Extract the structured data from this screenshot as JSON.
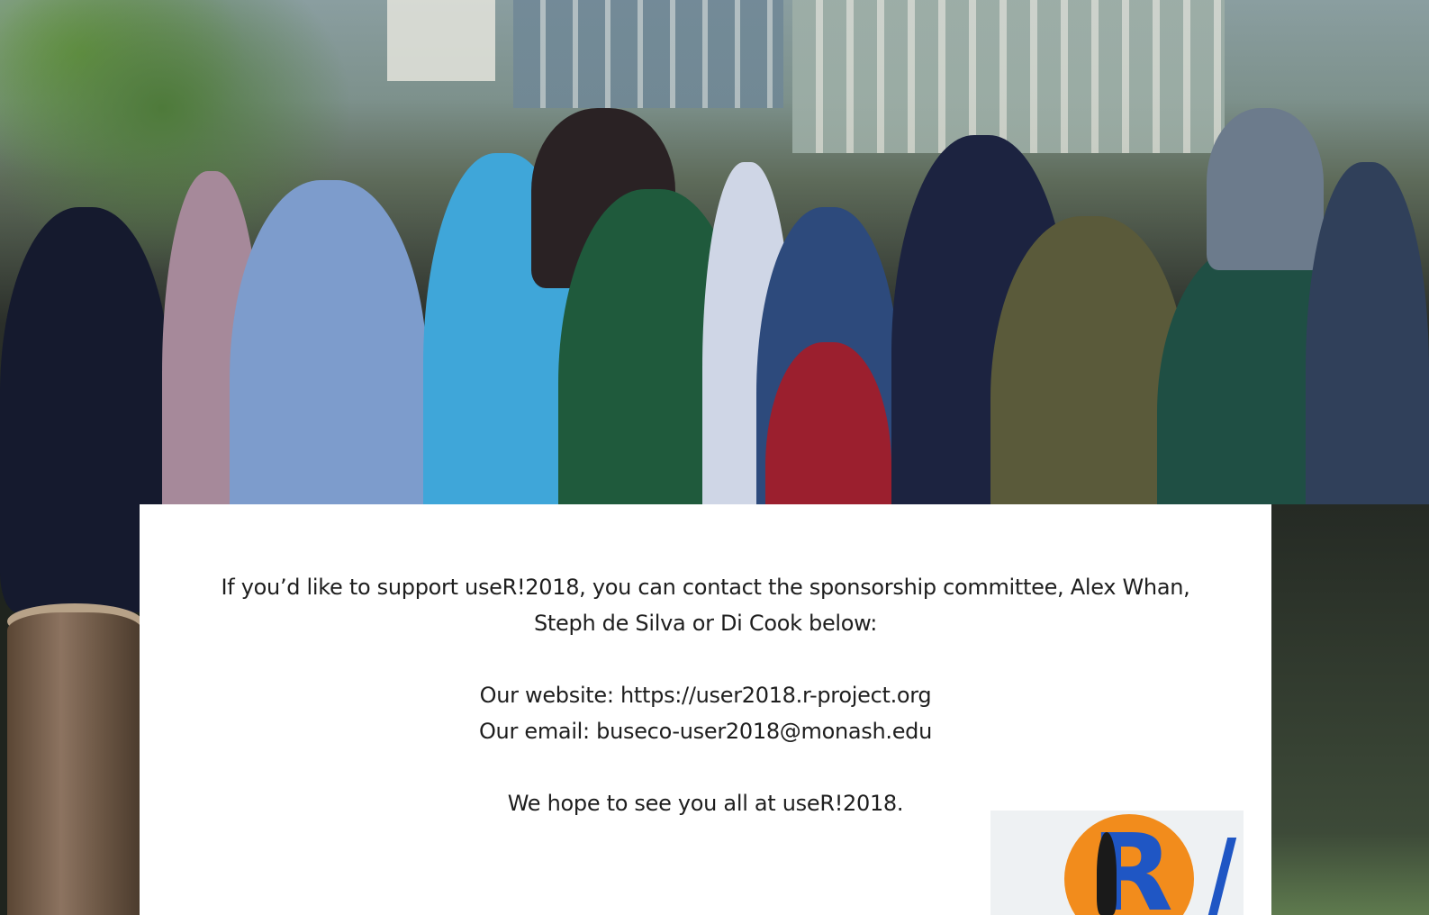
{
  "card": {
    "line1": "If you’d like to support useR!2018, you can contact the sponsorship committee, Alex Whan,",
    "line2": "Steph de Silva or Di Cook below:",
    "website_line": "Our website: https://user2018.r-project.org",
    "email_line": "Our email: buseco-user2018@monash.edu",
    "closing_line": "We hope to see you all at useR!2018."
  },
  "logo": {
    "letter": "R"
  },
  "colors": {
    "card_background": "#ffffff",
    "text": "#1e1e1e",
    "logo_orange": "#f28c1c",
    "logo_blue": "#1f56c4"
  }
}
